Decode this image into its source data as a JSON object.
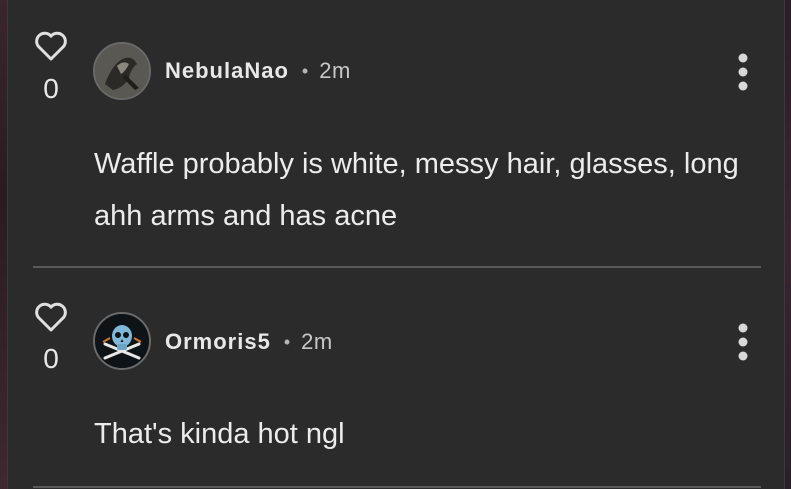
{
  "comments": [
    {
      "likes": "0",
      "username": "NebulaNao",
      "separator": "•",
      "time": "2m",
      "text": "Waffle probably is white, messy hair, glasses, long ahh arms and has acne",
      "avatar_icon": "profile-image-icon"
    },
    {
      "likes": "0",
      "username": "Ormoris5",
      "separator": "•",
      "time": "2m",
      "text": "That's kinda hot ngl",
      "avatar_icon": "skull-crossbones-icon"
    }
  ],
  "colors": {
    "background": "#2b2b2b",
    "text": "#ececec",
    "divider": "#5a5a5a"
  }
}
